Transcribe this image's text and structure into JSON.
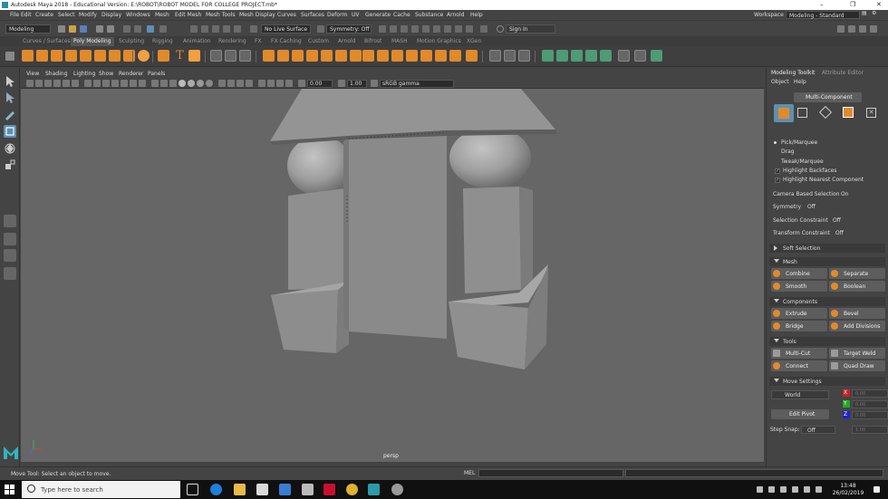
{
  "window": {
    "title": "Autodesk Maya 2018 - Educational Version: E:\\ROBOT\\ROBOT MODEL FOR COLLEGE PROJECT.mb*",
    "controls": [
      "–",
      "❐",
      "✕"
    ]
  },
  "menubar": {
    "items": [
      "File",
      "Edit",
      "Create",
      "Select",
      "Modify",
      "Display",
      "Windows",
      "Mesh",
      "Edit Mesh",
      "Mesh Tools",
      "Mesh Display",
      "Curves",
      "Surfaces",
      "Deform",
      "UV",
      "Generate",
      "Cache",
      "Substance",
      "Arnold",
      "Help"
    ],
    "workspace_label": "Workspace :",
    "workspace_value": "Modeling - Standard"
  },
  "statusline": {
    "menuset": "Modeling",
    "live_surface": "No Live Surface",
    "symmetry": "Symmetry: Off",
    "sign_in": "Sign In"
  },
  "shelf": {
    "tabs": [
      "Curves / Surfaces",
      "Poly Modeling",
      "Sculpting",
      "Rigging",
      "Animation",
      "Rendering",
      "FX",
      "FX Caching",
      "Custom",
      "Arnold",
      "Bifrost",
      "MASH",
      "Motion Graphics",
      "XGen"
    ],
    "active_tab": "Poly Modeling"
  },
  "viewport": {
    "menu": [
      "View",
      "Shading",
      "Lighting",
      "Show",
      "Renderer",
      "Panels"
    ],
    "near_value": "0.00",
    "far_value": "1.00",
    "color_space": "sRGB gamma",
    "camera": "persp"
  },
  "modeling_toolkit": {
    "tabs": [
      "Modeling Toolkit",
      "Attribute Editor"
    ],
    "menu": [
      "Object",
      "Help"
    ],
    "mode_label": "Multi-Component",
    "pick_options": [
      "Pick/Marquee",
      "Drag",
      "Tweak/Marquee"
    ],
    "checkbox_options": [
      "Highlight Backfaces",
      "Highlight Nearest Component"
    ],
    "camera_based_selection": {
      "label": "Camera Based Selection",
      "value": "On"
    },
    "symmetry": {
      "label": "Symmetry",
      "value": "Off"
    },
    "selection_constraint": {
      "label": "Selection Constraint",
      "value": "Off"
    },
    "transform_constraint": {
      "label": "Transform Constraint",
      "value": "Off"
    },
    "soft_selection": "Soft Selection",
    "sections": {
      "mesh": {
        "title": "Mesh",
        "buttons": [
          "Combine",
          "Separate",
          "Smooth",
          "Boolean"
        ]
      },
      "components": {
        "title": "Components",
        "buttons": [
          "Extrude",
          "Bevel",
          "Bridge",
          "Add Divisions"
        ]
      },
      "tools": {
        "title": "Tools",
        "buttons": [
          "Multi-Cut",
          "Target Weld",
          "Connect",
          "Quad Draw"
        ]
      },
      "move_settings": {
        "title": "Move Settings",
        "space": "World",
        "axes": [
          "X",
          "Y",
          "Z"
        ],
        "axis_values": [
          "0.00",
          "0.00",
          "0.00"
        ],
        "edit_pivot": "Edit Pivot",
        "step_snap_label": "Step Snap:",
        "step_snap_value": "Off",
        "step_snap_amount": "1.00"
      }
    }
  },
  "helpline": {
    "text": "Move Tool: Select an object to move.",
    "mel_label": "MEL"
  },
  "taskbar": {
    "search_placeholder": "Type here to search",
    "time": "13:48",
    "date": "26/02/2019"
  },
  "colors": {
    "accent": "#e08a2c",
    "selection": "#5d8fb3",
    "green_icons": "#4e9b75",
    "viewport_bg": "#666666"
  }
}
